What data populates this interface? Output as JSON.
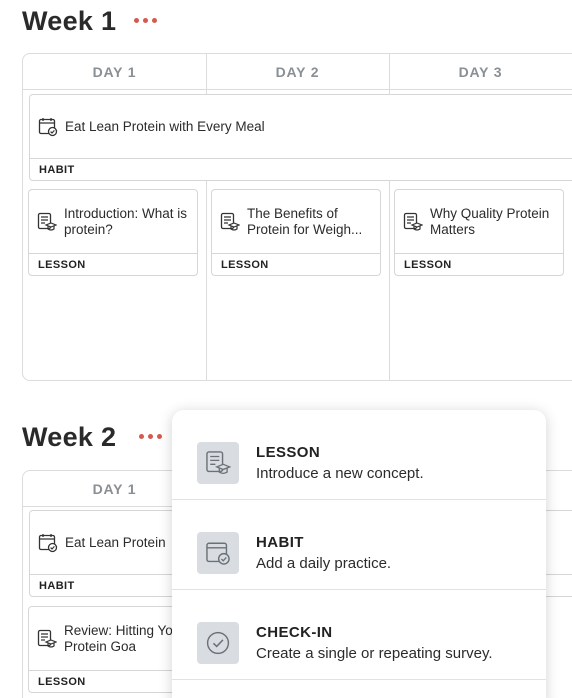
{
  "weeks": [
    {
      "title": "Week 1",
      "days": [
        "DAY 1",
        "DAY 2",
        "DAY 3"
      ],
      "habit": {
        "title": "Eat Lean Protein with Every Meal",
        "type": "HABIT",
        "icon": "habit-icon"
      },
      "lessons": [
        {
          "title": "Introduction: What is protein?",
          "type": "LESSON",
          "icon": "lesson-icon"
        },
        {
          "title": "The Benefits of Protein for Weigh...",
          "type": "LESSON",
          "icon": "lesson-icon"
        },
        {
          "title": "Why Quality Protein Matters",
          "type": "LESSON",
          "icon": "lesson-icon"
        }
      ]
    },
    {
      "title": "Week 2",
      "days": [
        "DAY 1"
      ],
      "habit": {
        "title": "Eat Lean Protein",
        "type": "HABIT",
        "icon": "habit-icon"
      },
      "lessons": [
        {
          "title": "Review: Hitting Your Protein Goa",
          "type": "LESSON",
          "icon": "lesson-icon"
        }
      ]
    }
  ],
  "add_menu": {
    "items": [
      {
        "label": "LESSON",
        "description": "Introduce a new concept.",
        "icon": "lesson-icon"
      },
      {
        "label": "HABIT",
        "description": "Add a daily practice.",
        "icon": "habit-icon"
      },
      {
        "label": "CHECK-IN",
        "description": "Create a single or repeating survey.",
        "icon": "check-in-icon"
      }
    ]
  },
  "colors": {
    "accent_dots": "#d45a4e",
    "menu_icon_bg": "#d9dde2",
    "day_header": "#8a8f94",
    "border": "#dcdcdc"
  }
}
